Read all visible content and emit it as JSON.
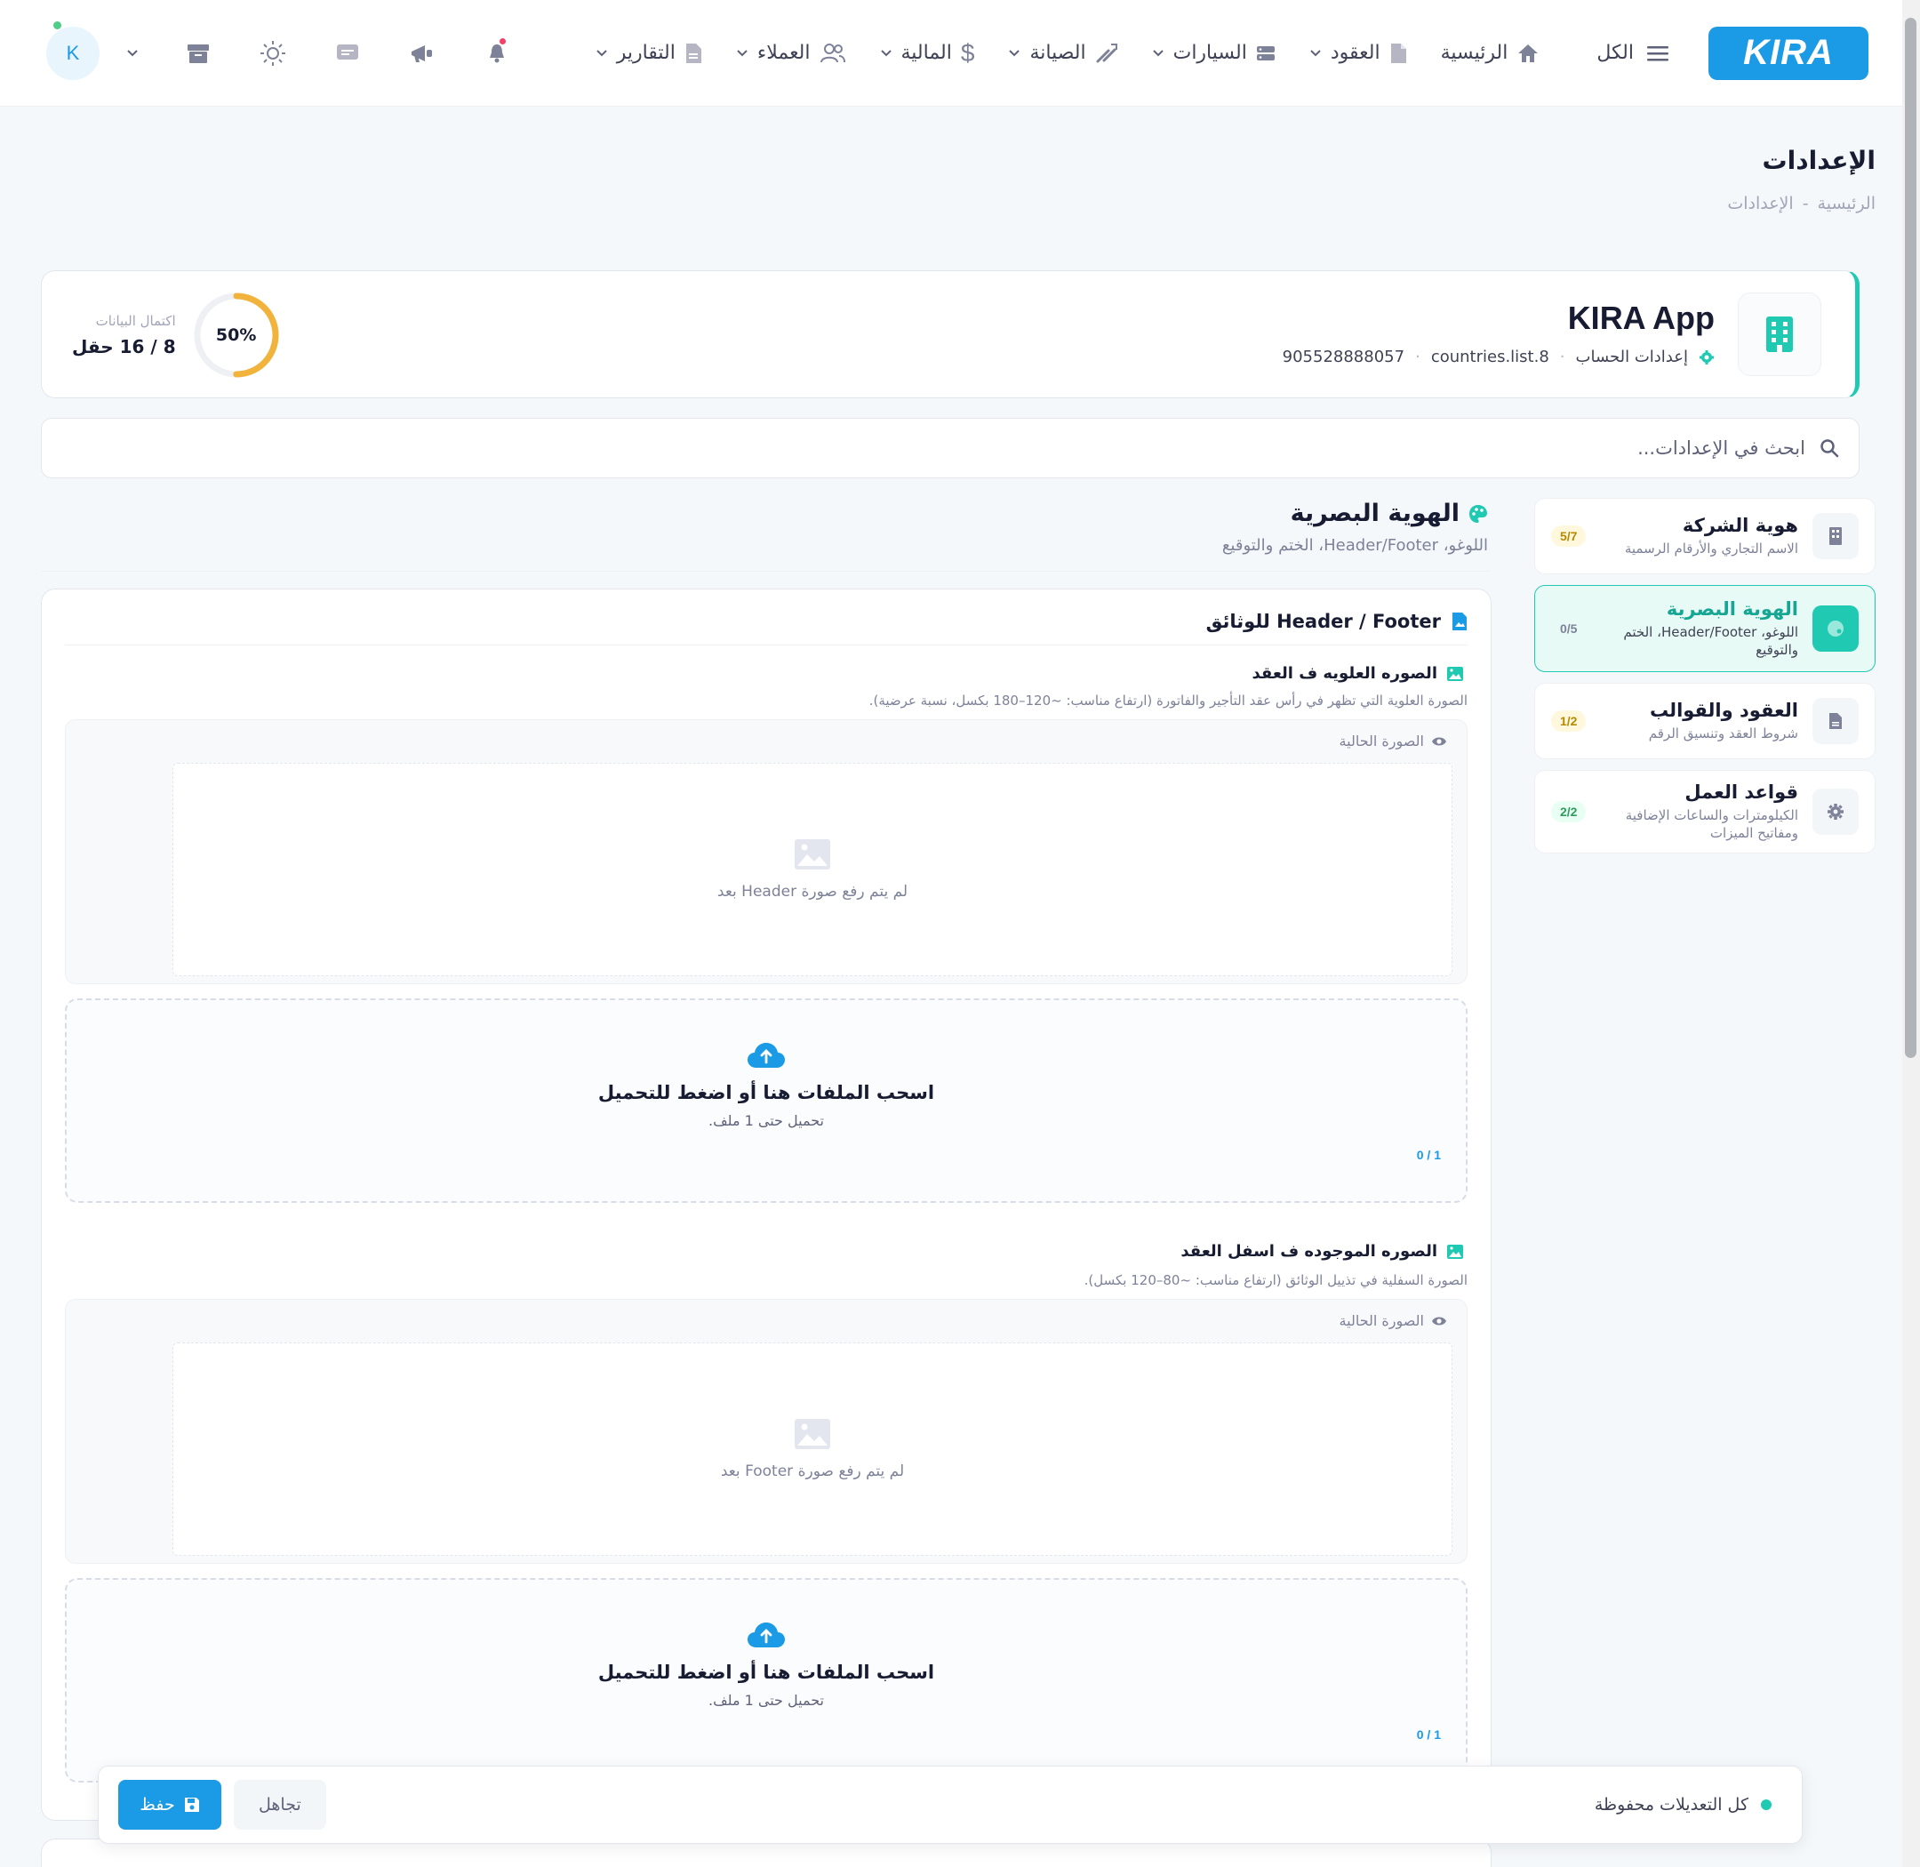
{
  "nav": {
    "logo": "KIRA",
    "all_label": "الكل",
    "items": [
      {
        "label": "الرئيسية",
        "icon": "home-icon"
      },
      {
        "label": "العقود",
        "icon": "document-icon"
      },
      {
        "label": "السيارات",
        "icon": "car-icon"
      },
      {
        "label": "الصيانة",
        "icon": "wrench-icon"
      },
      {
        "label": "المالية",
        "icon": "dollar-icon"
      },
      {
        "label": "العملاء",
        "icon": "users-icon"
      },
      {
        "label": "التقارير",
        "icon": "report-icon"
      }
    ],
    "avatar_initial": "K"
  },
  "page": {
    "title": "الإعدادات",
    "breadcrumb": [
      "الرئيسية",
      "-",
      "الإعدادات"
    ]
  },
  "company": {
    "name": "KIRA App",
    "settings_label": "إعدادات الحساب",
    "country": "countries.list.8",
    "phone": "905528888057",
    "progress_percent": "50%",
    "progress_value": 0.5,
    "progress_label": "اكتمال البيانات",
    "progress_fields": "8 / 16 حقل"
  },
  "search": {
    "placeholder": "ابحث في الإعدادات..."
  },
  "sidebar": {
    "items": [
      {
        "title": "هوية الشركة",
        "sub": "الاسم التجاري والأرقام الرسمية",
        "badge": "5/7",
        "icon": "building-icon"
      },
      {
        "title": "الهوية البصرية",
        "sub": "اللوغو، Header/Footer، الختم والتوقيع",
        "badge": "0/5",
        "icon": "palette-icon"
      },
      {
        "title": "العقود والقوالب",
        "sub": "شروط العقد وتنسيق الرقم",
        "badge": "1/2",
        "icon": "file-icon"
      },
      {
        "title": "قواعد العمل",
        "sub": "الكيلومترات والساعات الإضافية ومفاتيح الميزات",
        "badge": "2/2",
        "icon": "gear-icon"
      }
    ]
  },
  "section": {
    "title": "الهوية البصرية",
    "subtitle": "اللوغو، Header/Footer، الختم والتوقيع"
  },
  "card": {
    "title": "Header / Footer للوثائق",
    "header_field": {
      "label": "الصوره العلويه ف العقد",
      "hint": "الصورة العلوية التي تظهر في رأس عقد التأجير والفاتورة (ارتفاع مناسب: ~120–180 بكسل، نسبة عرضية).",
      "current_label": "الصورة الحالية",
      "empty_text": "لم يتم رفع صورة Header بعد",
      "drop_title": "اسحب الملفات هنا أو اضغط للتحميل",
      "drop_sub": "تحميل حتى 1 ملف.",
      "count": "0 / 1"
    },
    "footer_field": {
      "label": "الصوره الموجوده ف اسفل العقد",
      "hint": "الصورة السفلية في تذييل الوثائق (ارتفاع مناسب: ~80–120 بكسل).",
      "current_label": "الصورة الحالية",
      "empty_text": "لم يتم رفع صورة Footer بعد",
      "drop_title": "اسحب الملفات هنا أو اضغط للتحميل",
      "drop_sub": "تحميل حتى 1 ملف.",
      "count": "0 / 1"
    }
  },
  "savebar": {
    "status": "كل التعديلات محفوظة",
    "ignore_label": "تجاهل",
    "save_label": "حفظ"
  },
  "colors": {
    "primary": "#1b9ae5",
    "teal": "#20c9b2",
    "progress": "#f1b33b"
  }
}
